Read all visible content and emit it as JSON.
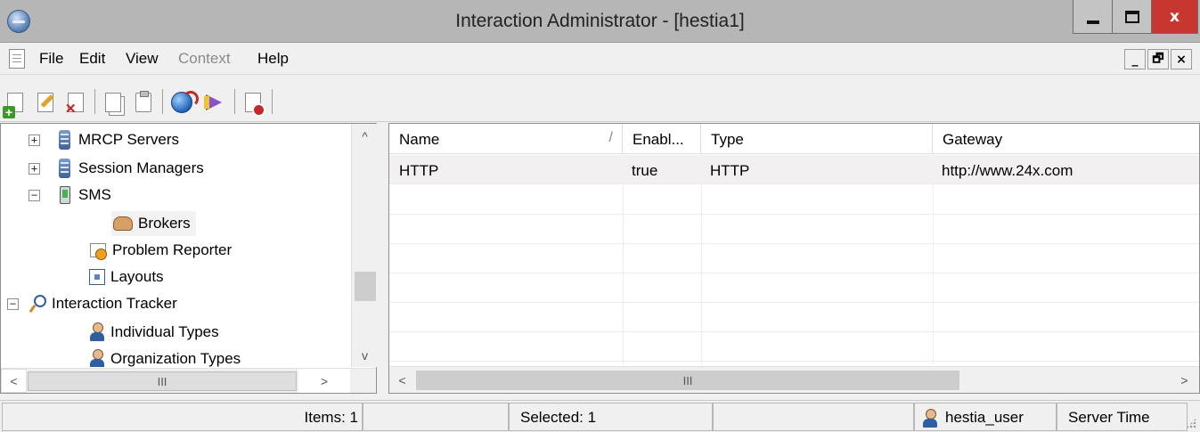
{
  "window": {
    "title": "Interaction Administrator - [hestia1]",
    "minimize_label": "–",
    "close_label": "x"
  },
  "menu": {
    "items": [
      {
        "label": "File",
        "disabled": false
      },
      {
        "label": "Edit",
        "disabled": false
      },
      {
        "label": "View",
        "disabled": false
      },
      {
        "label": "Context",
        "disabled": true
      },
      {
        "label": "Help",
        "disabled": false
      }
    ],
    "mdi_minimize": "_",
    "mdi_restore": "🗗",
    "mdi_close": "×"
  },
  "toolbar": {
    "icons": [
      "new-icon",
      "edit-icon",
      "delete-icon",
      "copy-icon",
      "paste-icon",
      "refresh-icon",
      "wizard-icon",
      "properties-icon"
    ]
  },
  "tree": {
    "items": [
      {
        "label": "MRCP Servers",
        "icon": "server-icon",
        "expander": "+"
      },
      {
        "label": "Session Managers",
        "icon": "server-icon",
        "expander": "+"
      },
      {
        "label": "SMS",
        "icon": "phone-icon",
        "expander": "−"
      },
      {
        "label": "Brokers",
        "icon": "handshake-icon",
        "expander": ""
      },
      {
        "label": "Problem Reporter",
        "icon": "bug-report-icon",
        "expander": ""
      },
      {
        "label": "Layouts",
        "icon": "layout-icon",
        "expander": ""
      },
      {
        "label": "Interaction Tracker",
        "icon": "search-icon",
        "expander": "−"
      },
      {
        "label": "Individual Types",
        "icon": "user-icon",
        "expander": ""
      },
      {
        "label": "Organization Types",
        "icon": "users-icon",
        "expander": ""
      }
    ],
    "scroll_up": "^",
    "scroll_down": "v",
    "scroll_left": "<",
    "scroll_right": ">",
    "thumb_grip": "III"
  },
  "list": {
    "columns": [
      "Name",
      "Enabl...",
      "Type",
      "Gateway"
    ],
    "sort_indicator": "/",
    "rows": [
      [
        "HTTP",
        "true",
        "HTTP",
        "http://www.24x.com"
      ]
    ],
    "scroll_left": "<",
    "scroll_right": ">",
    "thumb_grip": "III"
  },
  "status": {
    "items": "Items: 1",
    "selected": "Selected: 1",
    "user": "hestia_user",
    "server_time": "Server Time"
  }
}
